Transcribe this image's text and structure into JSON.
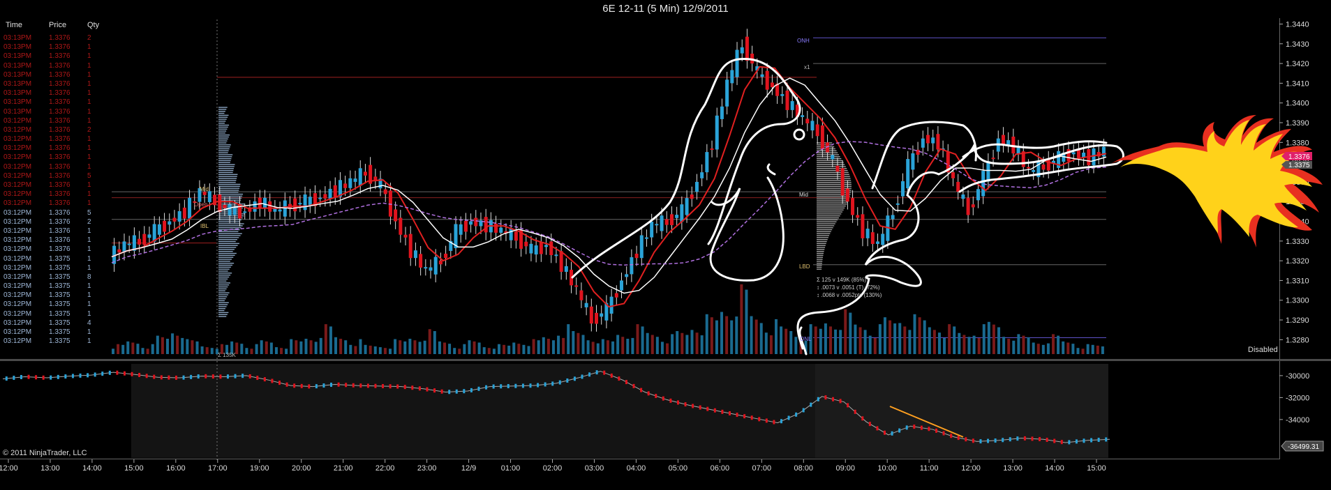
{
  "title": "6E 12-11 (5 Min)  12/9/2011",
  "time_sales": {
    "headers": [
      "Time",
      "Price",
      "Qty"
    ],
    "rows": [
      {
        "time": "03:13PM",
        "price": "1.3376",
        "qty": "2",
        "side": "sell"
      },
      {
        "time": "03:13PM",
        "price": "1.3376",
        "qty": "1",
        "side": "sell"
      },
      {
        "time": "03:13PM",
        "price": "1.3376",
        "qty": "1",
        "side": "sell"
      },
      {
        "time": "03:13PM",
        "price": "1.3376",
        "qty": "1",
        "side": "sell"
      },
      {
        "time": "03:13PM",
        "price": "1.3376",
        "qty": "1",
        "side": "sell"
      },
      {
        "time": "03:13PM",
        "price": "1.3376",
        "qty": "1",
        "side": "sell"
      },
      {
        "time": "03:13PM",
        "price": "1.3376",
        "qty": "1",
        "side": "sell"
      },
      {
        "time": "03:13PM",
        "price": "1.3376",
        "qty": "1",
        "side": "sell"
      },
      {
        "time": "03:13PM",
        "price": "1.3376",
        "qty": "1",
        "side": "sell"
      },
      {
        "time": "03:12PM",
        "price": "1.3376",
        "qty": "1",
        "side": "sell"
      },
      {
        "time": "03:12PM",
        "price": "1.3376",
        "qty": "2",
        "side": "sell"
      },
      {
        "time": "03:12PM",
        "price": "1.3376",
        "qty": "1",
        "side": "sell"
      },
      {
        "time": "03:12PM",
        "price": "1.3376",
        "qty": "1",
        "side": "sell"
      },
      {
        "time": "03:12PM",
        "price": "1.3376",
        "qty": "1",
        "side": "sell"
      },
      {
        "time": "03:12PM",
        "price": "1.3376",
        "qty": "1",
        "side": "sell"
      },
      {
        "time": "03:12PM",
        "price": "1.3376",
        "qty": "5",
        "side": "sell"
      },
      {
        "time": "03:12PM",
        "price": "1.3376",
        "qty": "1",
        "side": "sell"
      },
      {
        "time": "03:12PM",
        "price": "1.3376",
        "qty": "1",
        "side": "sell"
      },
      {
        "time": "03:12PM",
        "price": "1.3376",
        "qty": "1",
        "side": "sell"
      },
      {
        "time": "03:12PM",
        "price": "1.3376",
        "qty": "5",
        "side": "buy"
      },
      {
        "time": "03:12PM",
        "price": "1.3376",
        "qty": "2",
        "side": "buy"
      },
      {
        "time": "03:12PM",
        "price": "1.3376",
        "qty": "1",
        "side": "buy"
      },
      {
        "time": "03:12PM",
        "price": "1.3376",
        "qty": "1",
        "side": "buy"
      },
      {
        "time": "03:12PM",
        "price": "1.3376",
        "qty": "1",
        "side": "buy"
      },
      {
        "time": "03:12PM",
        "price": "1.3375",
        "qty": "1",
        "side": "buy"
      },
      {
        "time": "03:12PM",
        "price": "1.3375",
        "qty": "1",
        "side": "buy"
      },
      {
        "time": "03:12PM",
        "price": "1.3375",
        "qty": "8",
        "side": "buy"
      },
      {
        "time": "03:12PM",
        "price": "1.3375",
        "qty": "1",
        "side": "buy"
      },
      {
        "time": "03:12PM",
        "price": "1.3375",
        "qty": "1",
        "side": "buy"
      },
      {
        "time": "03:12PM",
        "price": "1.3375",
        "qty": "1",
        "side": "buy"
      },
      {
        "time": "03:12PM",
        "price": "1.3375",
        "qty": "1",
        "side": "buy"
      },
      {
        "time": "03:12PM",
        "price": "1.3375",
        "qty": "4",
        "side": "buy"
      },
      {
        "time": "03:12PM",
        "price": "1.3375",
        "qty": "1",
        "side": "buy"
      },
      {
        "time": "03:12PM",
        "price": "1.3375",
        "qty": "1",
        "side": "buy"
      }
    ]
  },
  "labels": {
    "onh": "ONH",
    "x1": "x1",
    "mid": "Mid",
    "open": "Open",
    "ib": "IBL",
    "onl": "ONL",
    "lbd": "LBD",
    "profile_total": "Σ 135K",
    "stats": [
      "Σ 125 v 149K (85%)",
      "↕ .0073 v .0051 (T) (72%)",
      "↕ .0068 v .0052pts (130%)"
    ],
    "last_price": "1.3376",
    "last_price2": "1.3375",
    "indicator_value": "-36499.31",
    "disabled": "Disabled",
    "copyright": "© 2011 NinjaTrader, LLC"
  },
  "colors": {
    "up": "#2aa3d8",
    "down": "#e0141e",
    "ema": "#e02020",
    "vwap": "#b070e0",
    "annotation": "#ffffff",
    "last_price": "#e0206a",
    "flame_outer": "#e83020",
    "flame_inner": "#ffd21a",
    "orange_line": "#ffa020"
  },
  "chart_data": [
    {
      "type": "candlestick",
      "title": "6E 12-11 (5 Min)  12/9/2011",
      "x_ticks": [
        "12:00",
        "13:00",
        "14:00",
        "15:00",
        "16:00",
        "17:00",
        "19:00",
        "20:00",
        "21:00",
        "22:00",
        "23:00",
        "12/9",
        "01:00",
        "02:00",
        "03:00",
        "04:00",
        "05:00",
        "06:00",
        "07:00",
        "08:00",
        "09:00",
        "10:00",
        "11:00",
        "12:00",
        "13:00",
        "14:00",
        "15:00"
      ],
      "y_ticks": [
        1.344,
        1.343,
        1.342,
        1.341,
        1.34,
        1.339,
        1.338,
        1.337,
        1.336,
        1.335,
        1.334,
        1.333,
        1.332,
        1.331,
        1.33,
        1.329,
        1.328
      ],
      "ylim": [
        1.3272,
        1.3443
      ],
      "close_path": [
        1.3322,
        1.3328,
        1.333,
        1.3335,
        1.334,
        1.3345,
        1.3355,
        1.335,
        1.3345,
        1.3345,
        1.335,
        1.3345,
        1.3348,
        1.335,
        1.3352,
        1.3356,
        1.336,
        1.3365,
        1.3358,
        1.334,
        1.3325,
        1.3315,
        1.332,
        1.3335,
        1.334,
        1.3338,
        1.3335,
        1.3332,
        1.3325,
        1.3328,
        1.3318,
        1.3305,
        1.329,
        1.3295,
        1.331,
        1.3325,
        1.3338,
        1.334,
        1.3345,
        1.336,
        1.338,
        1.341,
        1.343,
        1.3415,
        1.3408,
        1.34,
        1.3392,
        1.3385,
        1.337,
        1.335,
        1.3335,
        1.3328,
        1.3345,
        1.3368,
        1.3382,
        1.338,
        1.336,
        1.3345,
        1.3362,
        1.3382,
        1.3378,
        1.3365,
        1.3368,
        1.3372,
        1.3375,
        1.3372,
        1.3376
      ],
      "volume_path": [
        2,
        3,
        2,
        4,
        6,
        3,
        2,
        2,
        3,
        2,
        3,
        2,
        3,
        4,
        6,
        4,
        3,
        2,
        2,
        3,
        4,
        5,
        3,
        2,
        3,
        2,
        2,
        3,
        3,
        4,
        6,
        5,
        4,
        3,
        5,
        6,
        5,
        4,
        5,
        7,
        8,
        11,
        14,
        9,
        7,
        6,
        5,
        6,
        8,
        9,
        7,
        6,
        8,
        9,
        8,
        7,
        6,
        5,
        6,
        7,
        5,
        4,
        3,
        4,
        3,
        2,
        2
      ],
      "reference_lines": [
        {
          "label": "ONH",
          "value": 1.3433
        },
        {
          "label": "x1",
          "value": 1.342
        },
        {
          "label": "Mid",
          "value": 1.3355
        },
        {
          "label": "Open",
          "value": 1.3352
        },
        {
          "label": "IBL",
          "value": 1.3341
        },
        {
          "label": "LBD",
          "value": 1.3318
        },
        {
          "label": "ONL",
          "value": 1.3281
        }
      ],
      "last_price": 1.3376
    },
    {
      "type": "line",
      "y_ticks": [
        -30000,
        -32000,
        -34000
      ],
      "ylim": [
        -37500,
        -28800
      ],
      "values": [
        -30300,
        -30100,
        -30200,
        -30050,
        -29950,
        -29700,
        -29900,
        -30150,
        -30200,
        -30050,
        -30100,
        -30000,
        -30400,
        -30900,
        -31000,
        -30800,
        -30900,
        -30950,
        -31000,
        -31200,
        -31500,
        -31400,
        -31000,
        -30950,
        -30900,
        -30700,
        -30200,
        -29600,
        -30400,
        -31500,
        -32200,
        -32700,
        -33100,
        -33500,
        -33900,
        -34300,
        -33400,
        -31900,
        -32400,
        -34200,
        -35400,
        -34600,
        -34900,
        -35600,
        -36000,
        -35900,
        -35700,
        -35800,
        -36100,
        -35900,
        -35800
      ],
      "last_value": -36499.31
    }
  ]
}
